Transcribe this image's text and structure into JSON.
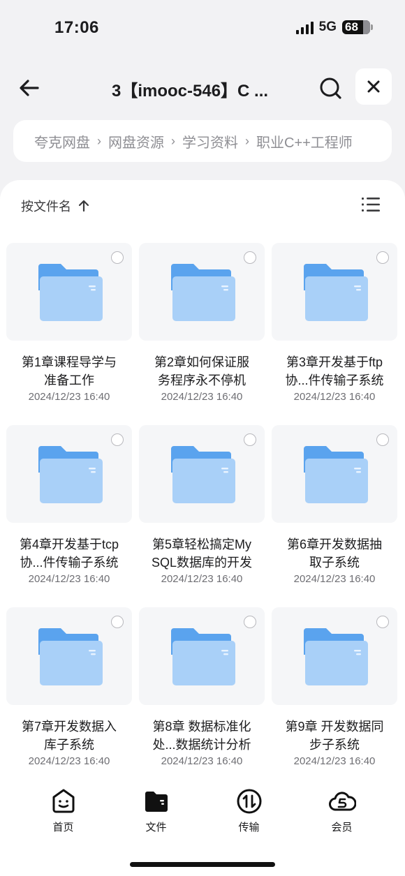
{
  "status": {
    "time": "17:06",
    "network": "5G",
    "battery": "68"
  },
  "header": {
    "title": "3【imooc-546】C ..."
  },
  "breadcrumb": [
    "夸克网盘",
    "网盘资源",
    "学习资料",
    "职业C++工程师"
  ],
  "sort": {
    "label": "按文件名"
  },
  "files": [
    {
      "name_line1": "第1章课程导学与",
      "name_line2": "准备工作",
      "date": "2024/12/23 16:40"
    },
    {
      "name_line1": "第2章如何保证服",
      "name_line2": "务程序永不停机",
      "date": "2024/12/23 16:40"
    },
    {
      "name_line1": "第3章开发基于ftp",
      "name_line2": "协...件传输子系统",
      "date": "2024/12/23 16:40"
    },
    {
      "name_line1": "第4章开发基于tcp",
      "name_line2": "协...件传输子系统",
      "date": "2024/12/23 16:40"
    },
    {
      "name_line1": "第5章轻松搞定My",
      "name_line2": "SQL数据库的开发",
      "date": "2024/12/23 16:40"
    },
    {
      "name_line1": "第6章开发数据抽",
      "name_line2": "取子系统",
      "date": "2024/12/23 16:40"
    },
    {
      "name_line1": "第7章开发数据入",
      "name_line2": "库子系统",
      "date": "2024/12/23 16:40"
    },
    {
      "name_line1": "第8章 数据标准化",
      "name_line2": "处...数据统计分析",
      "date": "2024/12/23 16:40"
    },
    {
      "name_line1": "第9章 开发数据同",
      "name_line2": "步子系统",
      "date": "2024/12/23 16:40"
    }
  ],
  "tabs": [
    {
      "label": "首页",
      "icon": "home-face-icon"
    },
    {
      "label": "文件",
      "icon": "folder-icon"
    },
    {
      "label": "传输",
      "icon": "transfer-icon"
    },
    {
      "label": "会员",
      "icon": "cloud-icon"
    }
  ],
  "colors": {
    "folder_back": "#5aa3ee",
    "folder_front": "#a9d0f8",
    "accent": "#111111"
  }
}
